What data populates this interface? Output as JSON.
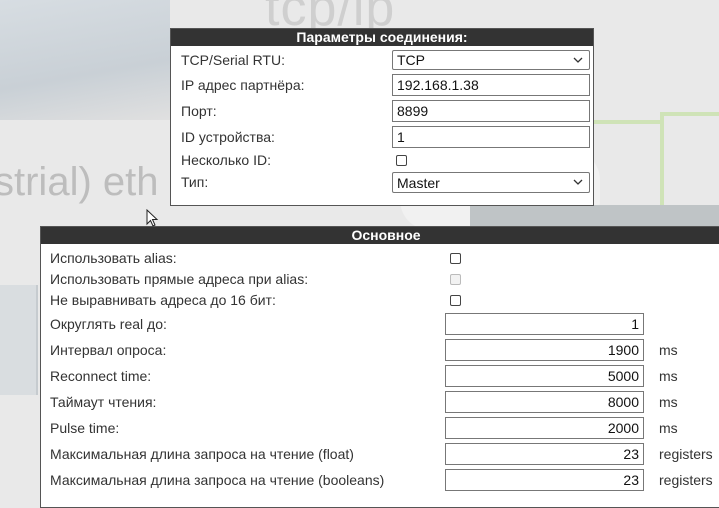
{
  "background": {
    "word_top": "tcp/ip",
    "word_left": "strial) eth"
  },
  "connection_panel": {
    "title": "Параметры соединения:",
    "protocol_label": "TCP/Serial RTU:",
    "protocol_value": "TCP",
    "ip_label": "IP адрес партнёра:",
    "ip_value": "192.168.1.38",
    "port_label": "Порт:",
    "port_value": "8899",
    "device_id_label": "ID устройства:",
    "device_id_value": "1",
    "multi_id_label": "Несколько ID:",
    "multi_id_checked": false,
    "type_label": "Тип:",
    "type_value": "Master"
  },
  "main_panel": {
    "title": "Основное",
    "use_alias_label": "Использовать alias:",
    "direct_addr_label": "Использовать прямые адреса при alias:",
    "no_align_label": "Не выравнивать адреса до 16 бит:",
    "round_real_label": "Округлять real до:",
    "round_real_value": "1",
    "poll_interval_label": "Интервал опроса:",
    "poll_interval_value": "1900",
    "poll_interval_unit": "ms",
    "reconnect_label": "Reconnect time:",
    "reconnect_value": "5000",
    "reconnect_unit": "ms",
    "read_timeout_label": "Таймаут чтения:",
    "read_timeout_value": "8000",
    "read_timeout_unit": "ms",
    "pulse_label": "Pulse time:",
    "pulse_value": "2000",
    "pulse_unit": "ms",
    "max_float_label": "Максимальная длина запроса на чтение (float)",
    "max_float_value": "23",
    "max_float_unit": "registers",
    "max_bool_label": "Максимальная длина запроса на чтение (booleans)",
    "max_bool_value": "23",
    "max_bool_unit": "registers"
  }
}
